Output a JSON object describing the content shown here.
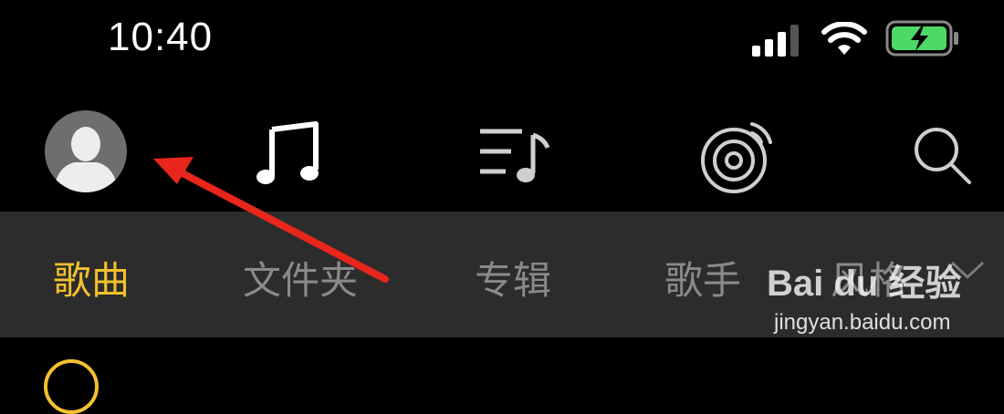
{
  "status_bar": {
    "time": "10:40",
    "signal_icon": "signal-bars-icon",
    "wifi_icon": "wifi-icon",
    "battery_icon": "battery-charging-icon",
    "battery_color": "#4cd964"
  },
  "top_nav": {
    "items": [
      {
        "icon": "avatar-icon"
      },
      {
        "icon": "music-note-icon"
      },
      {
        "icon": "playlist-icon"
      },
      {
        "icon": "radio-disc-icon"
      },
      {
        "icon": "search-icon"
      }
    ]
  },
  "tabs": {
    "items": [
      {
        "label": "歌曲",
        "active": true
      },
      {
        "label": "文件夹",
        "active": false
      },
      {
        "label": "专辑",
        "active": false
      },
      {
        "label": "歌手",
        "active": false
      },
      {
        "label": "风格",
        "active": false
      }
    ],
    "accent_color": "#f2c12e",
    "expand_icon": "chevron-down-icon"
  },
  "annotation": {
    "type": "red-arrow",
    "color": "#e8261c"
  },
  "watermark": {
    "logo": "Bai du 经验",
    "url": "jingyan.baidu.com"
  }
}
